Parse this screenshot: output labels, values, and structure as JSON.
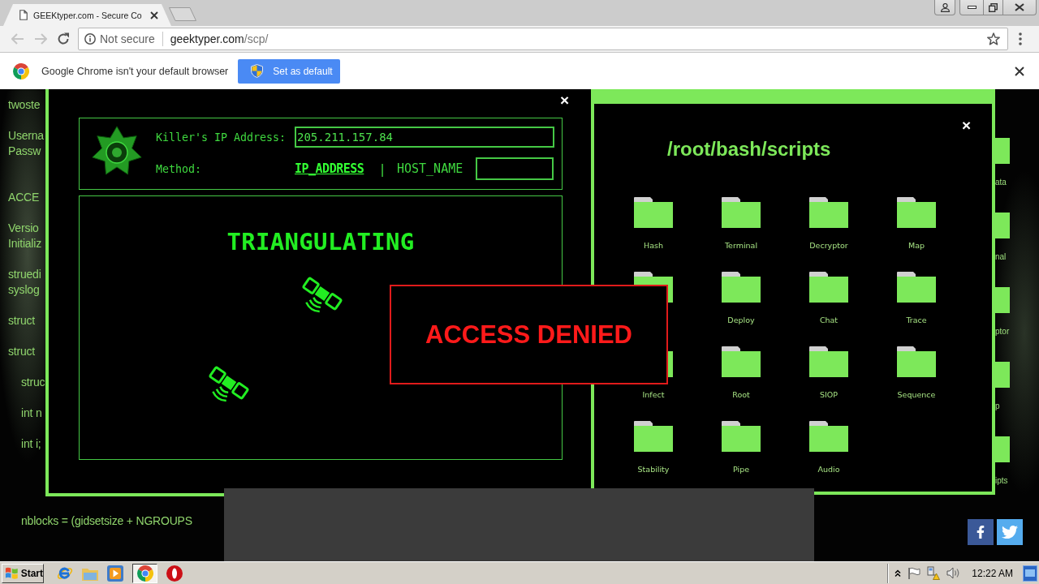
{
  "browser": {
    "tab": {
      "title": "GEEKtyper.com - Secure Co"
    },
    "address": {
      "security": "Not secure",
      "host": "geektyper.com",
      "path": "/scp/"
    }
  },
  "infobar": {
    "message": "Google Chrome isn't your default browser",
    "button": "Set as default"
  },
  "background": {
    "code": [
      {
        "lines": [
          "twoste"
        ]
      },
      {
        "lines": [
          "Userna",
          "Passw"
        ]
      },
      {
        "lines": [
          "ACCE"
        ]
      },
      {
        "lines": [
          "Versio",
          "Initializ"
        ]
      },
      {
        "lines": [
          "struedi",
          "syslog"
        ]
      },
      {
        "lines": [
          "struct"
        ]
      },
      {
        "lines": [
          "struct"
        ],
        "children": [
          {
            "lines": [
              "struc"
            ]
          },
          {
            "lines": [
              "int n"
            ]
          },
          {
            "lines": [
              "int i;"
            ]
          },
          {
            "lines": [
              "nblocks = (gidsetsize + NGROUPS"
            ]
          }
        ]
      }
    ],
    "folders": [
      {
        "label": "ata"
      },
      {
        "label": "nal"
      },
      {
        "label": "ptor"
      },
      {
        "label": "p"
      },
      {
        "label": "ipts"
      }
    ]
  },
  "tracker_window": {
    "close": "×",
    "ip_label": "Killer's IP Address:",
    "ip_value": "205.211.157.84",
    "method_label": "Method:",
    "methods": [
      {
        "label": "IP_ADDRESS",
        "selected": true
      },
      {
        "label": "HOST_NAME",
        "selected": false
      }
    ],
    "separator": "|",
    "status": "TRIANGULATING"
  },
  "access_alert": {
    "message": "ACCESS DENIED"
  },
  "scripts_window": {
    "close": "×",
    "title": "/root/bash/scripts",
    "folders": [
      {
        "kind": "folder",
        "label": "Hash"
      },
      {
        "kind": "folder",
        "label": "Terminal"
      },
      {
        "kind": "folder",
        "label": "Decryptor"
      },
      {
        "kind": "folder",
        "label": "Map"
      },
      {
        "kind": "icon"
      },
      {
        "kind": "folder",
        "label": "Deploy"
      },
      {
        "kind": "folder",
        "label": "Chat"
      },
      {
        "kind": "folder",
        "label": "Trace"
      },
      {
        "kind": "folder",
        "label": "Infect"
      },
      {
        "kind": "folder",
        "label": "Root"
      },
      {
        "kind": "folder",
        "label": "SIOP"
      },
      {
        "kind": "folder",
        "label": "Sequence"
      },
      {
        "kind": "folder",
        "label": "Stability"
      },
      {
        "kind": "folder",
        "label": "Pipe"
      },
      {
        "kind": "folder",
        "label": "Audio"
      }
    ]
  },
  "social_links": [
    {
      "kind": "facebook"
    },
    {
      "kind": "twitter"
    }
  ],
  "taskbar": {
    "start": "Start",
    "apps": [
      {
        "kind": "ie",
        "selected": false
      },
      {
        "kind": "explorer",
        "selected": false
      },
      {
        "kind": "media",
        "selected": false
      },
      {
        "kind": "chrome",
        "selected": true
      },
      {
        "kind": "disc",
        "selected": false
      }
    ],
    "clock": "12:22 AM"
  }
}
